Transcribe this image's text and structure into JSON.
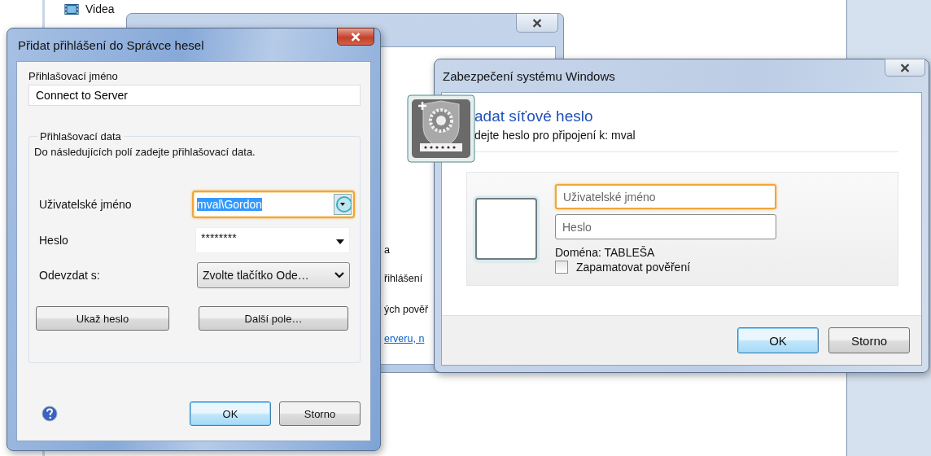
{
  "background": {
    "sidebar_item": "Videa",
    "fragments": [
      {
        "kind": "text",
        "text": "a"
      },
      {
        "kind": "text",
        "text": "řihlášení"
      },
      {
        "kind": "text",
        "text": "ých pověř"
      },
      {
        "kind": "link",
        "text": "erveru, n"
      }
    ]
  },
  "password_dialog": {
    "title": "Přidat přihlášení do Správce hesel",
    "login_name_label": "Přihlašovací jméno",
    "login_name_value": "Connect to Server",
    "group_title": "Přihlašovací data",
    "group_hint": "Do následujících polí zadejte přihlašovací data.",
    "fields": [
      {
        "label": "Uživatelské jméno",
        "kind": "combo",
        "value": "mval\\Gordon",
        "focused": true,
        "text_selected": true
      },
      {
        "label": "Heslo",
        "kind": "password",
        "value": "********",
        "focused": false,
        "text_selected": false
      },
      {
        "label": "Odevzdat s:",
        "kind": "select",
        "value": "Zvolte tlačítko Ode…",
        "focused": false,
        "text_selected": false
      }
    ],
    "buttons": [
      "Ukaž heslo",
      "Další pole…"
    ],
    "footer_buttons": [
      {
        "label": "OK",
        "default": true
      },
      {
        "label": "Storno",
        "default": false
      }
    ]
  },
  "security_dialog": {
    "title": "Zabezpečení systému Windows",
    "heading": "adat síťové heslo",
    "subtitle": "dejte heslo pro připojení k: mval",
    "username": {
      "placeholder": "Uživatelské jméno",
      "focused": true
    },
    "password": {
      "placeholder": "Heslo",
      "focused": false
    },
    "domain": "Doména: TABLEŠA",
    "remember": {
      "label": "Zapamatovat pověření",
      "checked": false
    },
    "footer_buttons": [
      {
        "label": "OK",
        "default": true
      },
      {
        "label": "Storno",
        "default": false
      }
    ]
  }
}
